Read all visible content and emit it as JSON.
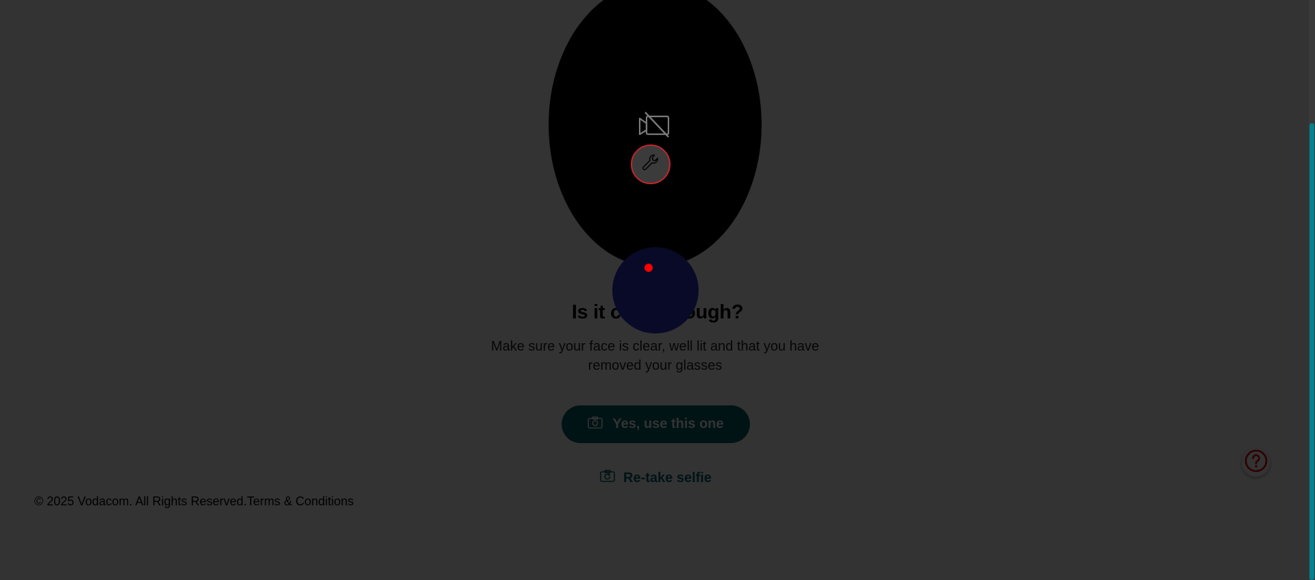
{
  "content": {
    "title": "Is it clear enough?",
    "subtitle": "Make sure your face is clear, well lit and that you have removed your glasses",
    "primary_button_label": "Yes, use this one",
    "secondary_link_label": "Re-take selfie"
  },
  "footer": {
    "copyright": "© 2025 Vodacom. All Rights Reserved.",
    "terms_label": "Terms & Conditions"
  },
  "icons": {
    "camera_status": "camera-off-icon",
    "tool": "wrench-icon",
    "primary_button": "camera-icon",
    "secondary_link": "camera-retake-icon",
    "help": "help-icon"
  },
  "colors": {
    "brand_teal": "#005f6b",
    "overlay": "rgba(0,0,0,0.8)",
    "accent_red": "#c2272d",
    "record_dot": "#ff0000",
    "scrollbar_thumb": "#00838f"
  }
}
